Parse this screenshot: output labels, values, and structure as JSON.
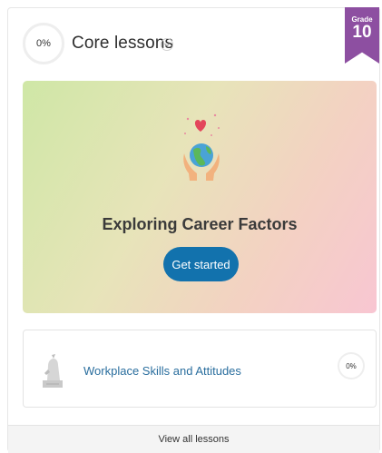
{
  "header": {
    "progress": "0%",
    "title": "Core lessons",
    "chevron_icon": "chevron-down-icon"
  },
  "grade_badge": {
    "label": "Grade",
    "number": "10",
    "color": "#8d4fa1"
  },
  "hero": {
    "illustration_icon": "hands-globe-heart-icon",
    "title": "Exploring Career Factors",
    "button_label": "Get started",
    "button_color": "#1272ad"
  },
  "lessons": [
    {
      "icon": "statue-icon",
      "title": "Workplace Skills and Attitudes",
      "progress": "0%"
    }
  ],
  "footer": {
    "link_label": "View all lessons"
  }
}
